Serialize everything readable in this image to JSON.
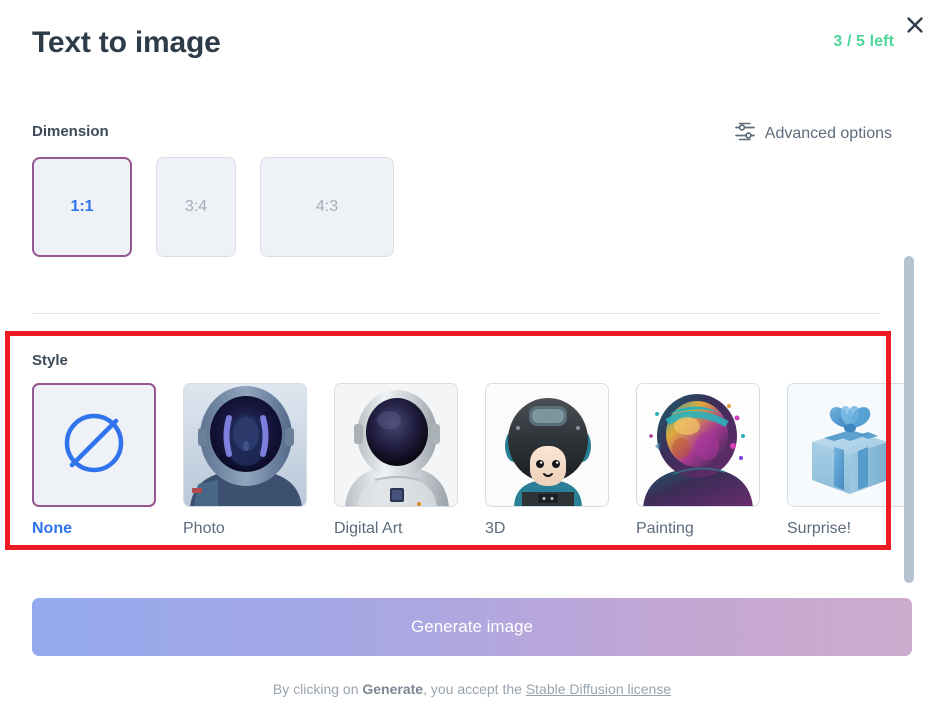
{
  "header": {
    "title": "Text to image",
    "credits": "3 / 5 left",
    "close_icon": "close-icon",
    "credits_color": "#4ed699"
  },
  "dimension": {
    "label": "Dimension",
    "options": [
      {
        "label": "1:1",
        "selected": true
      },
      {
        "label": "3:4",
        "selected": false
      },
      {
        "label": "4:3",
        "selected": false
      }
    ]
  },
  "advanced": {
    "label": "Advanced options",
    "icon": "sliders-icon"
  },
  "style": {
    "label": "Style",
    "options": [
      {
        "label": "None",
        "icon": "empty-set-icon",
        "selected": true
      },
      {
        "label": "Photo",
        "icon": "astronaut-photo-thumbnail",
        "selected": false
      },
      {
        "label": "Digital Art",
        "icon": "astronaut-digital-art-thumbnail",
        "selected": false
      },
      {
        "label": "3D",
        "icon": "astronaut-3d-thumbnail",
        "selected": false
      },
      {
        "label": "Painting",
        "icon": "astronaut-painting-thumbnail",
        "selected": false
      },
      {
        "label": "Surprise!",
        "icon": "gift-box-thumbnail",
        "selected": false
      }
    ]
  },
  "generate": {
    "label": "Generate image",
    "gradient_from": "#93a9ee",
    "gradient_to": "#cdaccd"
  },
  "footer": {
    "prefix": "By clicking on ",
    "bold": "Generate",
    "middle": ", you accept the ",
    "link": "Stable Diffusion license"
  },
  "annotation": {
    "highlight_color": "#ed1c24"
  },
  "scrollbar": {
    "thumb_color": "#b5c3d1"
  }
}
